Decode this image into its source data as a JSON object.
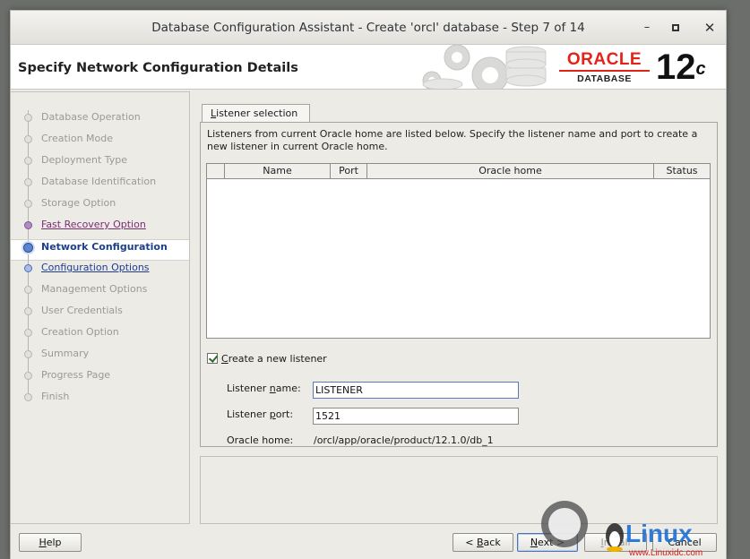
{
  "window": {
    "title": "Database Configuration Assistant - Create 'orcl' database - Step 7 of 14",
    "minimize_glyph": "–",
    "maximize_glyph": "▫",
    "close_glyph": "✕"
  },
  "header": {
    "page_title": "Specify Network Configuration Details",
    "brand_word": "ORACLE",
    "brand_sub": "DATABASE",
    "version_num": "12",
    "version_sup": "c"
  },
  "steps": [
    {
      "label": "Database Operation",
      "state": "disabled"
    },
    {
      "label": "Creation Mode",
      "state": "disabled"
    },
    {
      "label": "Deployment Type",
      "state": "disabled"
    },
    {
      "label": "Database Identification",
      "state": "disabled"
    },
    {
      "label": "Storage Option",
      "state": "disabled"
    },
    {
      "label": "Fast Recovery Option",
      "state": "visited"
    },
    {
      "label": "Network Configuration",
      "state": "current"
    },
    {
      "label": "Configuration Options",
      "state": "link"
    },
    {
      "label": "Management Options",
      "state": "disabled"
    },
    {
      "label": "User Credentials",
      "state": "disabled"
    },
    {
      "label": "Creation Option",
      "state": "disabled"
    },
    {
      "label": "Summary",
      "state": "disabled"
    },
    {
      "label": "Progress Page",
      "state": "disabled"
    },
    {
      "label": "Finish",
      "state": "disabled"
    }
  ],
  "tab": {
    "label_first": "L",
    "label_rest": "istener selection"
  },
  "main": {
    "intro": "Listeners from current Oracle home are listed below. Specify the listener name and port to create a new listener in current Oracle home.",
    "table": {
      "columns": [
        "",
        "Name",
        "Port",
        "Oracle home",
        "Status"
      ],
      "rows": []
    },
    "create_listener": {
      "label_first": "C",
      "label_rest": "reate a new listener",
      "checked": true
    },
    "listener_name": {
      "label_pre": "Listener ",
      "label_ul": "n",
      "label_post": "ame:",
      "value": "LISTENER"
    },
    "listener_port": {
      "label_pre": "Listener ",
      "label_ul": "p",
      "label_post": "ort:",
      "value": "1521"
    },
    "oracle_home": {
      "label": "Oracle home:",
      "value": "/orcl/app/oracle/product/12.1.0/db_1"
    }
  },
  "buttons": {
    "help_first": "H",
    "help_rest": "elp",
    "back_pre": "< ",
    "back_ul": "B",
    "back_rest": "ack",
    "next_ul": "N",
    "next_rest": "ext >",
    "install_ul": "I",
    "install_rest": "nstall",
    "cancel": "Cancel"
  },
  "watermark": {
    "text": "Linux",
    "sub": "www.Linuxidc.com"
  },
  "colors": {
    "oracle_red": "#e2231a",
    "current_step": "#1d3f8c",
    "visited_step": "#7a2e6f",
    "link_step": "#1f3c90"
  }
}
